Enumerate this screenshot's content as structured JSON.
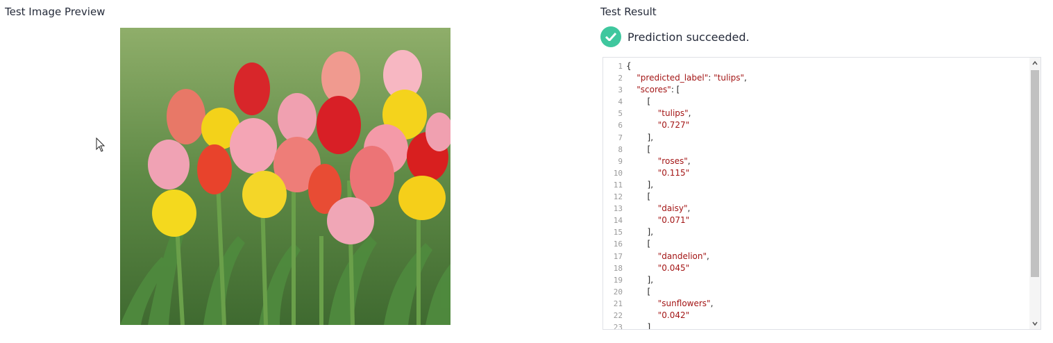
{
  "preview": {
    "title": "Test Image Preview",
    "image": {
      "subject": "tulips"
    }
  },
  "result": {
    "title": "Test Result",
    "status_text": "Prediction succeeded.",
    "status_color": "#3fc79e"
  },
  "code_lines": [
    "{",
    "    \"predicted_label\": \"tulips\",",
    "    \"scores\": [",
    "        [",
    "            \"tulips\",",
    "            \"0.727\"",
    "        ],",
    "        [",
    "            \"roses\",",
    "            \"0.115\"",
    "        ],",
    "        [",
    "            \"daisy\",",
    "            \"0.071\"",
    "        ],",
    "        [",
    "            \"dandelion\",",
    "            \"0.045\"",
    "        ],",
    "        [",
    "            \"sunflowers\",",
    "            \"0.042\"",
    "        ]"
  ],
  "line_numbers": [
    "1",
    "2",
    "3",
    "4",
    "5",
    "6",
    "7",
    "8",
    "9",
    "10",
    "11",
    "12",
    "13",
    "14",
    "15",
    "16",
    "17",
    "18",
    "19",
    "20",
    "21",
    "22",
    "23"
  ]
}
